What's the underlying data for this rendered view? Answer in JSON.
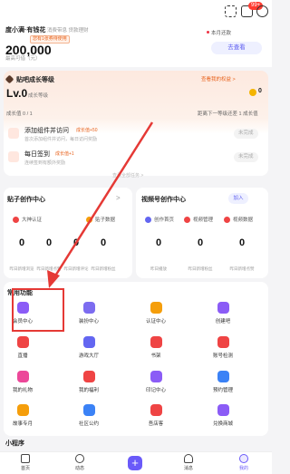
{
  "topbar": {
    "badge": "99+"
  },
  "account": {
    "brand": "度小满·有钱花",
    "subtitle": "消费带息 贷款理财",
    "tag": "您有1张券待使用",
    "balance": "200,000",
    "balance_label": "最高可借（元）",
    "month": "本月还款",
    "receive_button": "去查看"
  },
  "growth": {
    "title": "贴吧成长等级",
    "right_link": "查看我的权益 >",
    "level": "Lv.0",
    "level_sub": "成长等级",
    "coins": "0",
    "progress_left": "成长值 0 / 1",
    "progress_right": "距离下一等级还差 1 成长值",
    "tasks": [
      {
        "title": "添加组件并访问",
        "tag": "成长值+50",
        "sub": "首次添加组件并访问，每日访问奖励",
        "button": "未完成"
      },
      {
        "title": "每日签到",
        "tag": "成长值+1",
        "sub": "连续签到有额外奖励",
        "button": "未完成"
      }
    ],
    "more": "查看全部任务 >"
  },
  "tieba_creation": {
    "title": "贴子创作中心",
    "chevron": ">",
    "chips": [
      "大神认证",
      "贴子数据"
    ],
    "stats": [
      {
        "value": "0",
        "label": "昨日新增浏览"
      },
      {
        "value": "0",
        "label": "昨日新增点赞"
      },
      {
        "value": "0",
        "label": "昨日新增评论"
      },
      {
        "value": "0",
        "label": "昨日新增粉丝"
      }
    ]
  },
  "video_creation": {
    "title": "视频号创作中心",
    "join_button": "加入",
    "chips": [
      "创作首页",
      "视频管理",
      "视频数据"
    ],
    "stats": [
      {
        "value": "0",
        "label": "昨日播放"
      },
      {
        "value": "0",
        "label": "昨日新增粉丝"
      },
      {
        "value": "0",
        "label": "昨日新增点赞"
      }
    ]
  },
  "functions": {
    "title": "常用功能",
    "items": [
      {
        "label": "会员中心",
        "color": "#8b5cf6"
      },
      {
        "label": "装扮中心",
        "color": "#7c6cf0"
      },
      {
        "label": "认证中心",
        "color": "#f59e0b"
      },
      {
        "label": "创建吧",
        "color": "#8b5cf6"
      },
      {
        "label": "直播",
        "color": "#ef4444"
      },
      {
        "label": "游戏大厅",
        "color": "#6366f1"
      },
      {
        "label": "书架",
        "color": "#ef4444"
      },
      {
        "label": "账号检测",
        "color": "#ef4444"
      },
      {
        "label": "我的礼物",
        "color": "#ec4899"
      },
      {
        "label": "我的福利",
        "color": "#ef4444"
      },
      {
        "label": "印记中心",
        "color": "#8b5cf6"
      },
      {
        "label": "预约管理",
        "color": "#3b82f6"
      },
      {
        "label": "故事专月",
        "color": "#f59e0b"
      },
      {
        "label": "社区公约",
        "color": "#3b82f6"
      },
      {
        "label": "吾店客",
        "color": "#ef4444"
      },
      {
        "label": "兑换商城",
        "color": "#8b5cf6"
      }
    ]
  },
  "mini_programs": {
    "title": "小程序"
  },
  "nav": {
    "items": [
      "首页",
      "动态",
      "",
      "消息",
      "我的"
    ],
    "plus": "+"
  }
}
